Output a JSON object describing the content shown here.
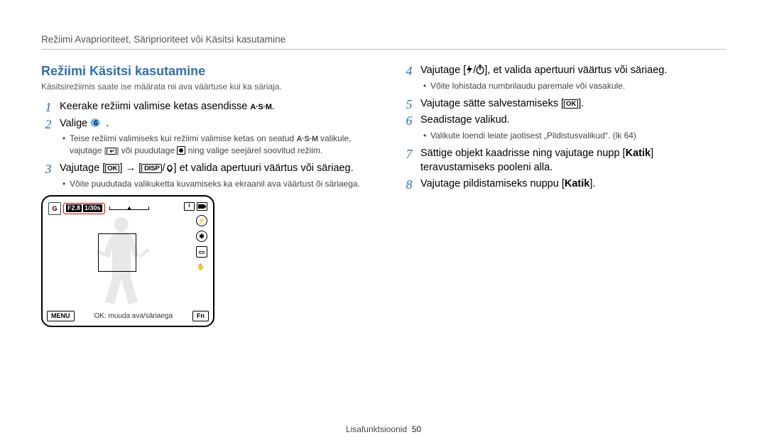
{
  "header": "Režiimi Avaprioriteet, Säriprioriteet või Käsitsi kasutamine",
  "title": "Režiimi Käsitsi kasutamine",
  "subtitle": "Käsitsirežiimis saate ise määrata nii ava väärtuse kui ka säriaja.",
  "left": {
    "s1": {
      "num": "1",
      "text_a": "Keerake režiimi valimise ketas asendisse ",
      "text_b": "."
    },
    "s2": {
      "num": "2",
      "text_a": "Valige ",
      "text_b": ".",
      "bullets": {
        "b1": "Teise režiimi valimiseks kui režiimi valimise ketas on seatud ",
        "asm_tail": " valikule, vajutage [",
        "b1b": "] või puudutage ",
        "b1c": " ning valige seejärel soovitud režiim."
      }
    },
    "s3": {
      "num": "3",
      "text_a": "Vajutage [",
      "text_b": "] → [",
      "text_c": "/",
      "text_d": "] et valida apertuuri väärtus või säriaeg.",
      "bullets": {
        "b1": "Võite puudutada valikuketta kuvamiseks ka ekraanil ava väärtust õi säriaega."
      }
    }
  },
  "right": {
    "s4": {
      "num": "4",
      "text_a": "Vajutage [",
      "text_b": "/",
      "text_c": "], et valida apertuuri väärtus või säriaeg.",
      "bullets": {
        "b1": "Võite lohistada numbrilaudu paremale või vasakule."
      }
    },
    "s5": {
      "num": "5",
      "text_a": "Vajutage sätte salvestamiseks [",
      "text_b": "]."
    },
    "s6": {
      "num": "6",
      "text_a": "Seadistage valikud.",
      "bullets": {
        "b1": "Valikute loendi leiate jaotisest „Pildistusvalikud“. (lk 64)"
      }
    },
    "s7": {
      "num": "7",
      "text_a": "Sättige objekt kaadrisse ning vajutage nupp [",
      "katik": "Katik",
      "text_b": "] teravustamiseks pooleni alla."
    },
    "s8": {
      "num": "8",
      "text_a": "Vajutage pildistamiseks nuppu [",
      "katik": "Katik",
      "text_b": "]."
    }
  },
  "lcd": {
    "mode": "G",
    "fstop": "F2.8",
    "shutter": "1/30s",
    "top_right_1": "I",
    "menu": "MENU",
    "caption": "OK: muuda ava/säriaega",
    "fn": "Fn"
  },
  "btn": {
    "ok": "OK",
    "disp": "DISP"
  },
  "asm": "A·S·M",
  "footer": {
    "section": "Lisafunktsioonid",
    "page": "50"
  }
}
